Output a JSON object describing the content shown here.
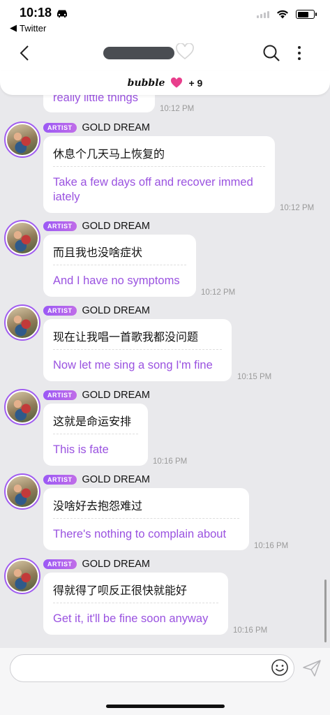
{
  "status_bar": {
    "time": "10:18",
    "back_app": "Twitter"
  },
  "header": {
    "brand": "bubble",
    "count": "+ 9"
  },
  "top_partial": {
    "en": "really little things",
    "time": "10:12 PM"
  },
  "messages": [
    {
      "badge": "ARTIST",
      "sender": "GOLD DREAM",
      "zh": "休息个几天马上恢复的",
      "en": "Take a few days off and recover immed iately",
      "time": "10:12 PM"
    },
    {
      "badge": "ARTIST",
      "sender": "GOLD DREAM",
      "zh": "而且我也没啥症状",
      "en": "And I have no symptoms",
      "time": "10:12 PM"
    },
    {
      "badge": "ARTIST",
      "sender": "GOLD DREAM",
      "zh": "现在让我唱一首歌我都没问题",
      "en": "Now let me sing a song I'm fine",
      "time": "10:15 PM"
    },
    {
      "badge": "ARTIST",
      "sender": "GOLD DREAM",
      "zh": "这就是命运安排",
      "en": "This is fate",
      "time": "10:16 PM"
    },
    {
      "badge": "ARTIST",
      "sender": "GOLD DREAM",
      "zh": "没啥好去抱怨难过",
      "en": "There's nothing to complain about",
      "time": "10:16 PM"
    },
    {
      "badge": "ARTIST",
      "sender": "GOLD DREAM",
      "zh": "得就得了呗反正很快就能好",
      "en": "Get it, it'll be fine soon anyway",
      "time": "10:16 PM"
    }
  ],
  "colors": {
    "accent": "#9a52e0",
    "badge": "#a05cf0",
    "heart": "#e83e8c"
  },
  "icons": [
    "chevron-left-icon",
    "heart-icon",
    "search-icon",
    "more-icon",
    "emoji-icon",
    "send-icon"
  ]
}
